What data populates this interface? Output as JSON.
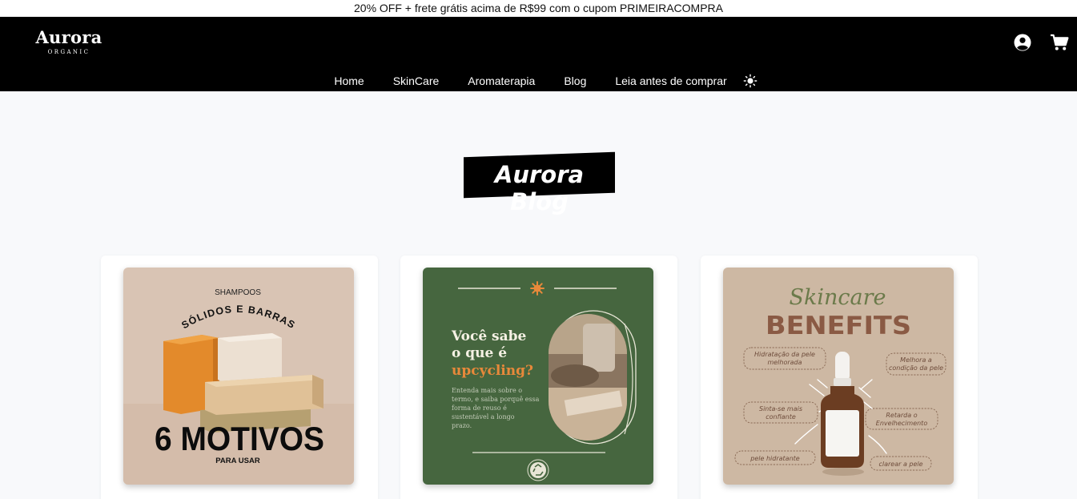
{
  "promo_text": "20% OFF + frete grátis acima de R$99 com o cupom PRIMEIRACOMPRA",
  "brand": {
    "name": "Aurora",
    "tagline": "ORGANIC"
  },
  "nav": {
    "items": [
      {
        "label": "Home"
      },
      {
        "label": "SkinCare"
      },
      {
        "label": "Aromaterapia"
      },
      {
        "label": "Blog"
      },
      {
        "label": "Leia antes de comprar"
      }
    ]
  },
  "header_icons": [
    "user-circle-icon",
    "shopping-cart-icon",
    "sun-icon"
  ],
  "page_title": "Aurora Blog",
  "posts": [
    {
      "kicker": "SHAMPOOS",
      "arc_text": "SÓLIDOS E BARRAS",
      "headline": "6 MOTIVOS",
      "footer": "PARA USAR"
    },
    {
      "headline_line1": "Você sabe",
      "headline_line2": "o que é",
      "headline_accent": "upcycling?",
      "body_line1": "Entenda mais sobre o",
      "body_line2": "termo, e saiba porquê essa",
      "body_line3": "forma de reuso é",
      "body_line4": "sustentável a longo",
      "body_line5": "prazo."
    },
    {
      "script_title": "Skincare",
      "headline": "BENEFITS",
      "benefits": [
        "Hidratação da pele",
        "melhorada",
        "Melhora a",
        "condição da pele",
        "Sinta-se mais",
        "confiante",
        "Retarda o",
        "Envelhecimento",
        "pele hidratante",
        "clarear a pele"
      ]
    }
  ],
  "colors": {
    "header_bg": "#000000",
    "page_bg": "#f8f9fb",
    "card1_bg": "#d9c4b4",
    "card2_bg": "#46663f",
    "card2_accent": "#e8893a",
    "card3_bg": "#cdb8a3",
    "card3_title": "#8a5a44",
    "card3_script": "#6b7a4a"
  }
}
